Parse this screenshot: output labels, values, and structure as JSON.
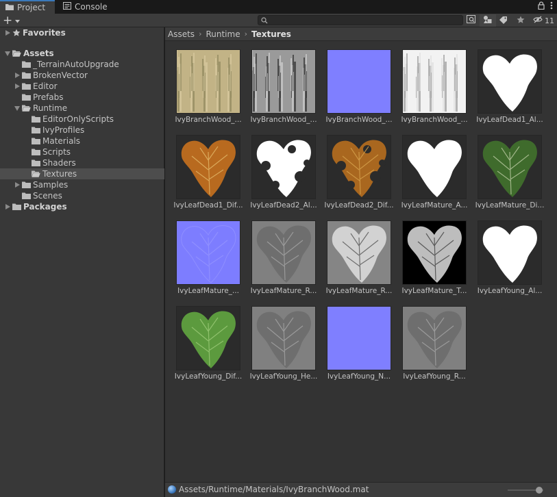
{
  "tabs": [
    {
      "label": "Project",
      "icon": "folder-icon",
      "active": true
    },
    {
      "label": "Console",
      "icon": "console-icon",
      "active": false
    }
  ],
  "toolbar": {
    "create_label": "+",
    "search_placeholder": "",
    "hidden_count": "11"
  },
  "tree": [
    {
      "label": "Favorites",
      "depth": 0,
      "arrow": "right",
      "icon": "star-icon",
      "bold": true
    },
    {
      "label": "Assets",
      "depth": 0,
      "arrow": "down",
      "icon": "folder-open-icon",
      "bold": true
    },
    {
      "label": "_TerrainAutoUpgrade",
      "depth": 1,
      "arrow": "none",
      "icon": "folder-icon"
    },
    {
      "label": "BrokenVector",
      "depth": 1,
      "arrow": "right",
      "icon": "folder-icon"
    },
    {
      "label": "Editor",
      "depth": 1,
      "arrow": "right",
      "icon": "folder-icon"
    },
    {
      "label": "Prefabs",
      "depth": 1,
      "arrow": "none",
      "icon": "folder-icon"
    },
    {
      "label": "Runtime",
      "depth": 1,
      "arrow": "down",
      "icon": "folder-open-icon"
    },
    {
      "label": "EditorOnlyScripts",
      "depth": 2,
      "arrow": "none",
      "icon": "folder-icon"
    },
    {
      "label": "IvyProfiles",
      "depth": 2,
      "arrow": "none",
      "icon": "folder-icon"
    },
    {
      "label": "Materials",
      "depth": 2,
      "arrow": "none",
      "icon": "folder-icon"
    },
    {
      "label": "Scripts",
      "depth": 2,
      "arrow": "none",
      "icon": "folder-icon"
    },
    {
      "label": "Shaders",
      "depth": 2,
      "arrow": "none",
      "icon": "folder-icon"
    },
    {
      "label": "Textures",
      "depth": 2,
      "arrow": "none",
      "icon": "folder-open-icon",
      "selected": true
    },
    {
      "label": "Samples",
      "depth": 1,
      "arrow": "right",
      "icon": "folder-icon"
    },
    {
      "label": "Scenes",
      "depth": 1,
      "arrow": "none",
      "icon": "folder-icon"
    },
    {
      "label": "Packages",
      "depth": 0,
      "arrow": "right",
      "icon": "folder-icon",
      "bold": true
    }
  ],
  "breadcrumb": [
    "Assets",
    "Runtime",
    "Textures"
  ],
  "assets": [
    {
      "label": "IvyBranchWood_...",
      "thumb": "bark-color"
    },
    {
      "label": "IvyBranchWood_...",
      "thumb": "bark-gray"
    },
    {
      "label": "IvyBranchWood_...",
      "thumb": "normal-flat"
    },
    {
      "label": "IvyBranchWood_...",
      "thumb": "bark-light"
    },
    {
      "label": "IvyLeafDead1_Al...",
      "thumb": "leaf-white-dark"
    },
    {
      "label": "IvyLeafDead1_Dif...",
      "thumb": "leaf-brown"
    },
    {
      "label": "IvyLeafDead2_Al...",
      "thumb": "leaf-holes-white"
    },
    {
      "label": "IvyLeafDead2_Dif...",
      "thumb": "leaf-holes-brown"
    },
    {
      "label": "IvyLeafMature_A...",
      "thumb": "leaf-white-dark"
    },
    {
      "label": "IvyLeafMature_Di...",
      "thumb": "leaf-green-dark"
    },
    {
      "label": "IvyLeafMature_...",
      "thumb": "normal-leaf"
    },
    {
      "label": "IvyLeafMature_R...",
      "thumb": "leaf-gray-mid"
    },
    {
      "label": "IvyLeafMature_R...",
      "thumb": "leaf-gray-light"
    },
    {
      "label": "IvyLeafMature_T...",
      "thumb": "leaf-gray-black"
    },
    {
      "label": "IvyLeafYoung_Al...",
      "thumb": "leaf-white-dark"
    },
    {
      "label": "IvyLeafYoung_Dif...",
      "thumb": "leaf-green-light"
    },
    {
      "label": "IvyLeafYoung_He...",
      "thumb": "leaf-gray-mid"
    },
    {
      "label": "IvyLeafYoung_N...",
      "thumb": "normal-flat"
    },
    {
      "label": "IvyLeafYoung_R...",
      "thumb": "leaf-gray-mid"
    }
  ],
  "footer": {
    "path": "Assets/Runtime/Materials/IvyBranchWood.mat",
    "icon": "material-sphere-icon",
    "zoom": 0.85
  },
  "colors": {
    "accent": "#3a79bb",
    "selection": "#4d4d4d",
    "normal_map": "#7d7dff"
  }
}
